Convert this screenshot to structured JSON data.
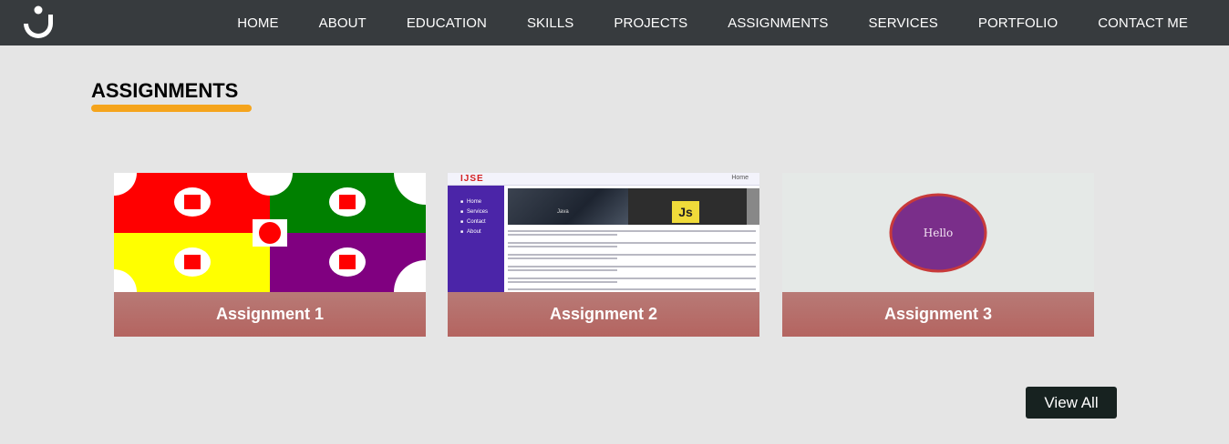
{
  "nav": {
    "items": [
      "HOME",
      "ABOUT",
      "EDUCATION",
      "SKILLS",
      "PROJECTS",
      "ASSIGNMENTS",
      "SERVICES",
      "PORTFOLIO",
      "CONTACT ME"
    ]
  },
  "section": {
    "title": "ASSIGNMENTS",
    "underline_color": "#f5a41c"
  },
  "cards": [
    {
      "label": "Assignment 1"
    },
    {
      "label": "Assignment 2",
      "thumb": {
        "logo": "IJSE",
        "top_link": "Home",
        "menu": [
          "Home",
          "Services",
          "Contact",
          "About"
        ],
        "banner_labels": [
          "Java",
          "Js"
        ]
      }
    },
    {
      "label": "Assignment 3",
      "thumb": {
        "text": "Hello"
      }
    }
  ],
  "view_all": {
    "label": "View All"
  },
  "colors": {
    "navbar": "#373b3e",
    "background": "#e5e5e5",
    "card_footer": "#b46460",
    "button": "#172220"
  }
}
